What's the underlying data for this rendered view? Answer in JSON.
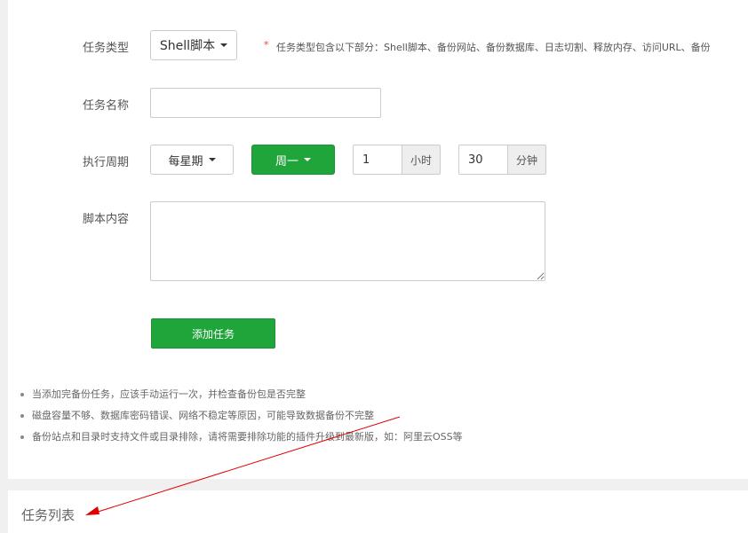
{
  "form": {
    "task_type": {
      "label": "任务类型",
      "value": "Shell脚本",
      "required_mark": "*",
      "note": "任务类型包含以下部分：Shell脚本、备份网站、备份数据库、日志切割、释放内存、访问URL、备份"
    },
    "task_name": {
      "label": "任务名称",
      "value": ""
    },
    "period": {
      "label": "执行周期",
      "cycle": "每星期",
      "weekday": "周一",
      "hour_value": "1",
      "hour_unit": "小时",
      "minute_value": "30",
      "minute_unit": "分钟"
    },
    "script": {
      "label": "脚本内容",
      "value": ""
    },
    "submit_label": "添加任务"
  },
  "tips": [
    "当添加完备份任务，应该手动运行一次，并检查备份包是否完整",
    "磁盘容量不够、数据库密码错误、网络不稳定等原因，可能导致数据备份不完整",
    "备份站点和目录时支持文件或目录排除，请将需要排除功能的插件升级到最新版，如：阿里云OSS等"
  ],
  "task_list": {
    "title": "任务列表"
  },
  "colors": {
    "primary_green": "#20a53a",
    "annotation_red": "#e00000"
  }
}
